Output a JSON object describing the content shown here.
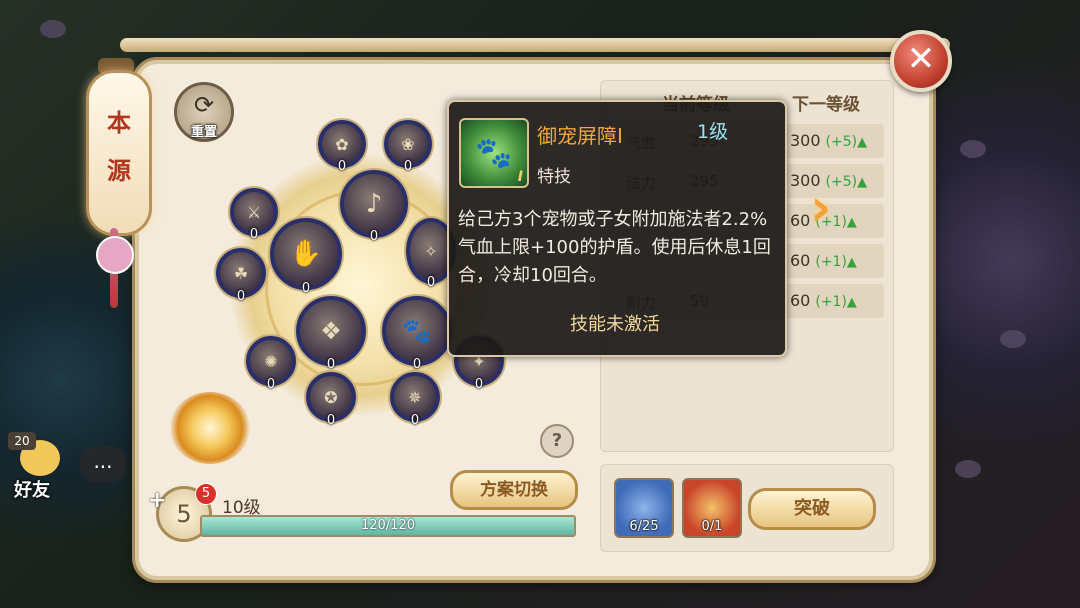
{
  "left_tab": {
    "line1": "本",
    "line2": "源"
  },
  "reset": {
    "label": "重置"
  },
  "wheel": {
    "nodes": [
      {
        "level": "0"
      },
      {
        "level": "0"
      },
      {
        "level": "0"
      },
      {
        "level": "0"
      },
      {
        "level": "0"
      },
      {
        "level": "0"
      },
      {
        "level": "0"
      },
      {
        "level": "0"
      },
      {
        "level": "0"
      },
      {
        "level": "0"
      },
      {
        "level": "0"
      },
      {
        "level": "0"
      },
      {
        "level": "0"
      }
    ]
  },
  "scheme_switch_label": "方案切换",
  "help_label": "?",
  "level_panel": {
    "points": "5",
    "badge_count": "5",
    "level_text": "10级",
    "progress_text": "120/120",
    "progress_fraction": 1.0
  },
  "stats_table": {
    "col_current": "当前等级",
    "col_next": "下一等级",
    "rows": [
      {
        "label": "气血",
        "current": "295",
        "next": "300",
        "inc": "(+5)"
      },
      {
        "label": "法力",
        "current": "295",
        "next": "300",
        "inc": "(+5)"
      },
      {
        "label": "",
        "current": "",
        "next": "60",
        "inc": "(+1)"
      },
      {
        "label": "",
        "current": "",
        "next": "60",
        "inc": "(+1)"
      },
      {
        "label": "耐力",
        "current": "59",
        "next": "60",
        "inc": "(+1)"
      }
    ]
  },
  "items": [
    {
      "count": "6/25",
      "color": "#3f6bb8"
    },
    {
      "count": "0/1",
      "color": "#c9452a"
    }
  ],
  "breakthrough_label": "突破",
  "friends": {
    "label": "好友",
    "badge": "20",
    "chat_icon": "..."
  },
  "tooltip": {
    "name": "御宠屏障I",
    "level": "1级",
    "type": "特技",
    "description": "给己方3个宠物或子女附加施法者2.2%气血上限+100的护盾。使用后休息1回合，冷却10回合。",
    "status": "技能未激活",
    "icon_numeral": "I"
  },
  "colors": {
    "accent_orange": "#f4a640",
    "accent_cyan": "#9de0f0",
    "increase_green": "#37a23c"
  }
}
